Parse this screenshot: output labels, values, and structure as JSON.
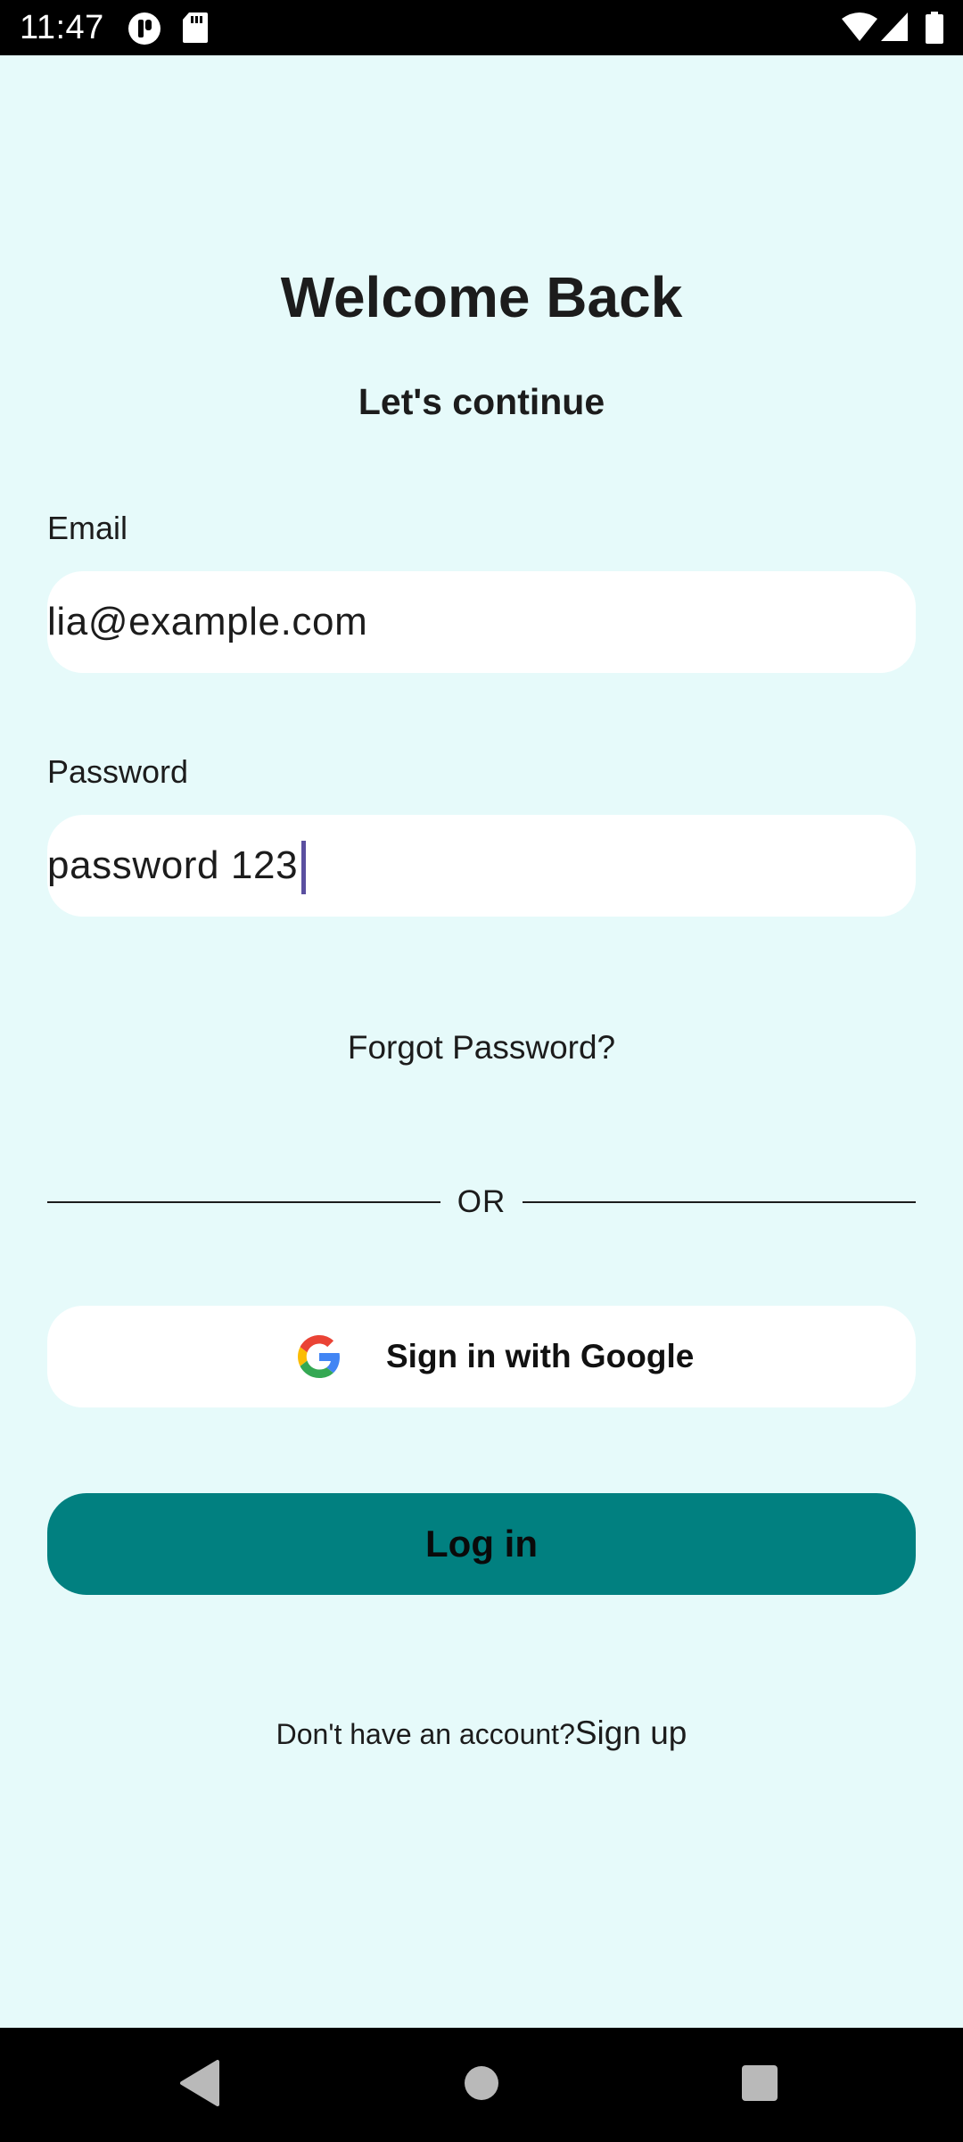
{
  "status_bar": {
    "time": "11:47",
    "left_icons": [
      "privacy-indicator-icon",
      "sd-card-icon"
    ],
    "right_icons": [
      "wifi-icon",
      "cell-signal-icon",
      "battery-icon"
    ]
  },
  "login": {
    "title": "Welcome Back",
    "subtitle": "Let's continue",
    "email_label": "Email",
    "email_value": "lia@example.com",
    "password_label": "Password",
    "password_value": "password 123",
    "forgot_password": "Forgot Password?",
    "divider_text": "OR",
    "google_button": "Sign in with Google",
    "login_button": "Log in",
    "signup_prompt": "Don't have an account?",
    "signup_link": "Sign up"
  },
  "colors": {
    "background": "#e6fafa",
    "primary": "#018080",
    "field_background": "#ffffff",
    "caret": "#5a4fa0"
  },
  "nav_bar": {
    "icons": [
      "back-icon",
      "home-icon",
      "recents-icon"
    ]
  }
}
